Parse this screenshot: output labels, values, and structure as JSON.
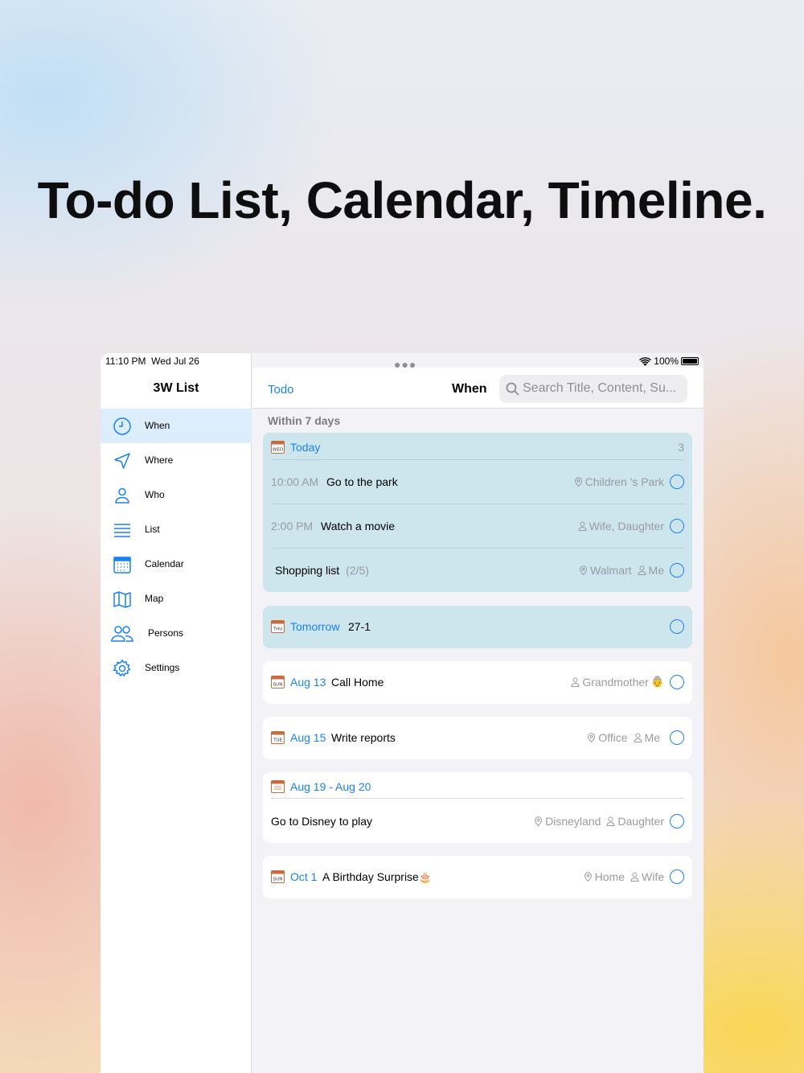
{
  "headline": "To-do List, Calendar, Timeline.",
  "status_bar": {
    "time": "11:10 PM",
    "date": "Wed Jul 26",
    "battery": "100%"
  },
  "sidebar": {
    "title": "3W List",
    "items": [
      {
        "label": "When",
        "icon": "clock-icon",
        "selected": true
      },
      {
        "label": "Where",
        "icon": "location-arrow-icon"
      },
      {
        "label": "Who",
        "icon": "person-icon"
      },
      {
        "label": "List",
        "icon": "list-icon"
      },
      {
        "label": "Calendar",
        "icon": "calendar-icon"
      },
      {
        "label": "Map",
        "icon": "map-icon"
      },
      {
        "label": "Persons",
        "icon": "persons-icon"
      },
      {
        "label": "Settings",
        "icon": "gear-icon"
      }
    ]
  },
  "navbar": {
    "back_label": "Todo",
    "title": "When",
    "search_placeholder": "Search Title, Content, Su..."
  },
  "section_header": "Within 7 days",
  "today_card": {
    "date_label": "Today",
    "count": "3",
    "items": [
      {
        "time": "10:00 AM",
        "title": "Go to the park",
        "place": "Children 's Park"
      },
      {
        "time": "2:00 PM",
        "title": "Watch a movie",
        "people": "Wife, Daughter"
      },
      {
        "title": "Shopping list",
        "progress": "(2/5)",
        "place": "Walmart",
        "people": "Me"
      }
    ]
  },
  "tomorrow_card": {
    "date_label": "Tomorrow",
    "title": "27-1"
  },
  "cards": [
    {
      "date_label": "Aug 13",
      "title": "Call Home",
      "people": "Grandmother",
      "emoji": "👵"
    },
    {
      "date_label": "Aug 15",
      "title": "Write reports",
      "place": "Office",
      "people": "Me"
    }
  ],
  "range_card": {
    "date_label": "Aug 19 - Aug 20",
    "title": "Go to Disney to play",
    "place": "Disneyland",
    "people": "Daughter"
  },
  "birthday_card": {
    "date_label": "Oct 1",
    "title": "A Birthday Surprise",
    "emoji": "🎂",
    "place": "Home",
    "people": "Wife"
  },
  "colors": {
    "accent": "#1a82f0",
    "card_highlight": "#cde5ec",
    "selected_nav": "#dcedfb"
  }
}
